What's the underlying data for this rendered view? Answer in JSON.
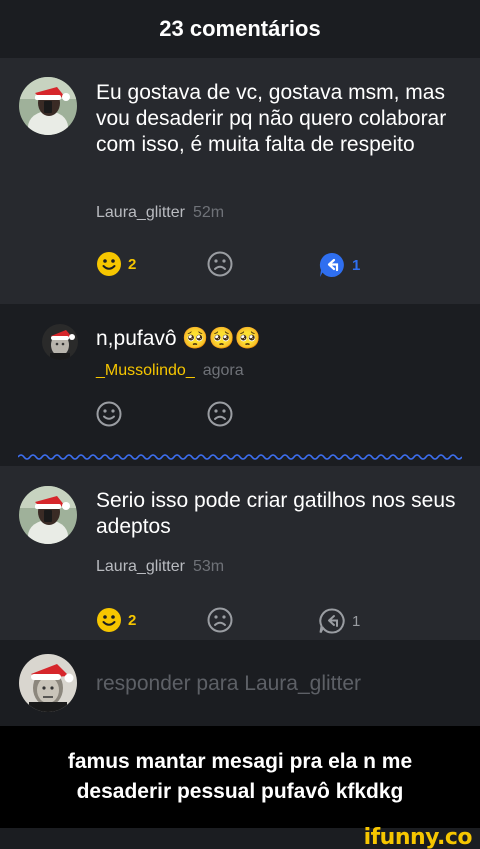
{
  "header": {
    "title": "23 comentários"
  },
  "comments": [
    {
      "text": "Eu gostava de vc, gostava msm, mas vou desaderir pq não quero colaborar com isso, é muita falta de respeito",
      "author": "Laura_glitter",
      "time": "52m",
      "smile_count": "2",
      "reply_count": "1"
    },
    {
      "text": "n,pufavô 🥺🥺🥺",
      "author": "_Mussolindo_",
      "time": "agora"
    },
    {
      "text": "Serio isso pode criar gatilhos nos seus adeptos",
      "author": "Laura_glitter",
      "time": "53m",
      "smile_count": "2",
      "reply_count": "1"
    }
  ],
  "reply_bar": {
    "placeholder": "responder para Laura_glitter"
  },
  "caption": {
    "text": "famus mantar mesagi pra ela n me desaderir pessual pufavô kfkdkg"
  },
  "watermark": "ifunny.co",
  "colors": {
    "accent_yellow": "#f6c600",
    "reply_blue": "#2f6ff0",
    "card_bg": "#27292e",
    "page_bg": "#1b1d21"
  }
}
